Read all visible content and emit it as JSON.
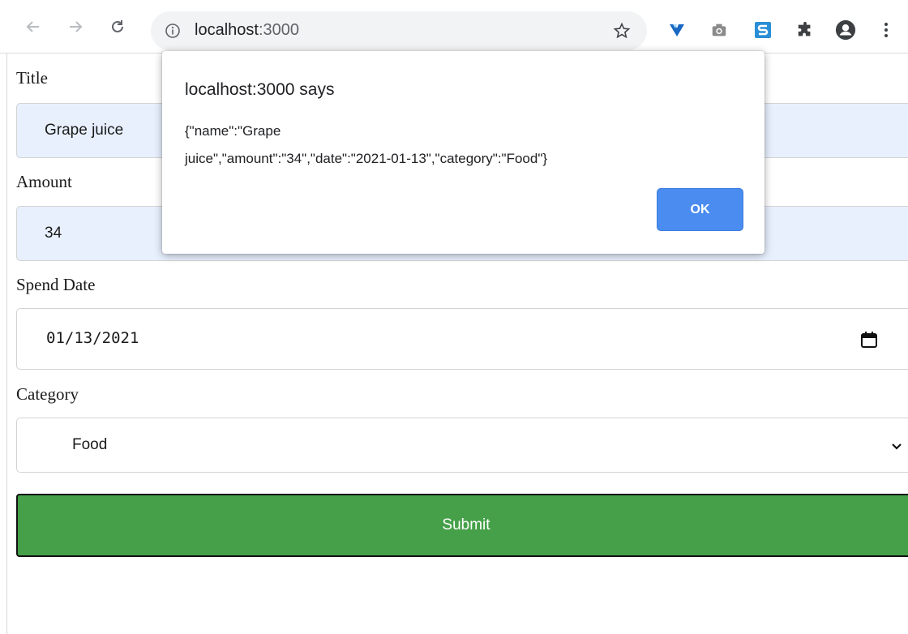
{
  "browser": {
    "back_icon": "arrow-left-icon",
    "forward_icon": "arrow-right-icon",
    "reload_icon": "reload-icon",
    "info_icon": "info-icon",
    "url_host": "localhost",
    "url_port": ":3000",
    "bookmark_icon": "star-icon",
    "extensions": [
      "vuetify-icon",
      "camera-icon",
      "s-extension-icon",
      "puzzle-icon"
    ],
    "profile_icon": "profile-icon",
    "menu_icon": "more-vert-icon"
  },
  "form": {
    "title_label": "Title",
    "title_value": "Grape juice",
    "amount_label": "Amount",
    "amount_value": "34",
    "date_label": "Spend Date",
    "date_value": "01/13/2021",
    "category_label": "Category",
    "category_value": "Food",
    "submit_label": "Submit"
  },
  "dialog": {
    "title": "localhost:3000 says",
    "message": "{\"name\":\"Grape\njuice\",\"amount\":\"34\",\"date\":\"2021-01-13\",\"category\":\"Food\"}",
    "ok_label": "OK"
  },
  "colors": {
    "submit_bg": "#46a049",
    "ok_bg": "#4a8cef",
    "autofill_bg": "#e8f0fe"
  }
}
